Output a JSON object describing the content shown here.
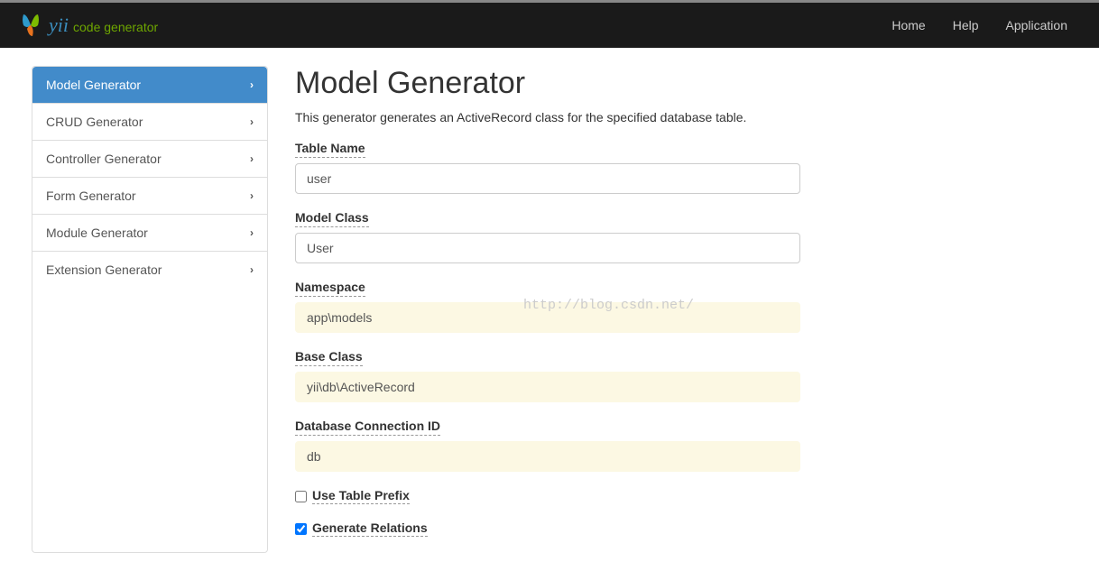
{
  "brand": {
    "yii": "yii",
    "sub": "code generator"
  },
  "nav": {
    "home": "Home",
    "help": "Help",
    "application": "Application"
  },
  "sidebar": {
    "items": [
      {
        "label": "Model Generator"
      },
      {
        "label": "CRUD Generator"
      },
      {
        "label": "Controller Generator"
      },
      {
        "label": "Form Generator"
      },
      {
        "label": "Module Generator"
      },
      {
        "label": "Extension Generator"
      }
    ]
  },
  "page": {
    "title": "Model Generator",
    "description": "This generator generates an ActiveRecord class for the specified database table."
  },
  "form": {
    "table_name": {
      "label": "Table Name",
      "value": "user"
    },
    "model_class": {
      "label": "Model Class",
      "value": "User"
    },
    "namespace": {
      "label": "Namespace",
      "value": "app\\models"
    },
    "base_class": {
      "label": "Base Class",
      "value": "yii\\db\\ActiveRecord"
    },
    "db_connection": {
      "label": "Database Connection ID",
      "value": "db"
    },
    "use_table_prefix": {
      "label": "Use Table Prefix",
      "checked": false
    },
    "generate_relations": {
      "label": "Generate Relations",
      "checked": true
    }
  },
  "watermark": "http://blog.csdn.net/"
}
